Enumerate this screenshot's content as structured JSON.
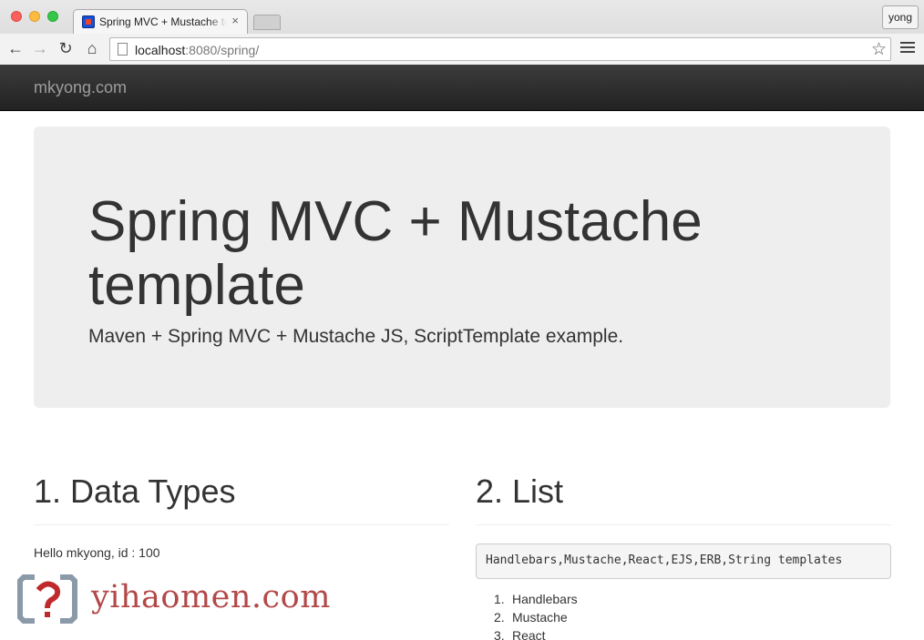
{
  "browser": {
    "tab_title": "Spring MVC + Mustache template",
    "tab_close": "×",
    "profile_name": "yong",
    "url_host": "localhost",
    "url_rest": ":8080/spring/",
    "icons": {
      "back": "←",
      "forward": "→",
      "reload": "↻",
      "home": "⌂",
      "star": "☆"
    }
  },
  "navbar": {
    "brand": "mkyong.com"
  },
  "jumbotron": {
    "title": "Spring MVC + Mustache template",
    "subtitle": "Maven + Spring MVC + Mustache JS, ScriptTemplate example."
  },
  "sections": {
    "data_types": {
      "title": "1. Data Types",
      "text": "Hello mkyong, id : 100"
    },
    "list": {
      "title": "2. List",
      "pre": "Handlebars,Mustache,React,EJS,ERB,String templates",
      "items": [
        {
          "num": "1.",
          "label": "Handlebars"
        },
        {
          "num": "2.",
          "label": "Mustache"
        },
        {
          "num": "3.",
          "label": "React"
        }
      ]
    }
  },
  "watermark": {
    "text": "yihaomen.com"
  },
  "colors": {
    "navbar": "#222222",
    "jumbotron": "#eeeeee",
    "brand": "#9d9d9d",
    "watermark": "#b34848"
  }
}
